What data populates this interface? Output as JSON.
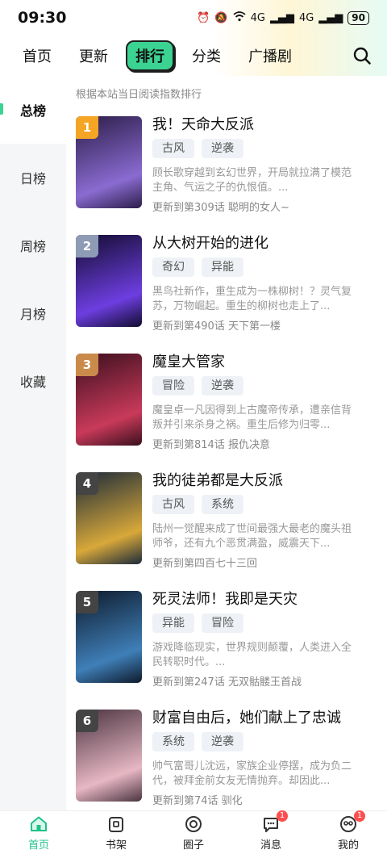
{
  "status_bar": {
    "time": "09:30",
    "signal_a": "4G",
    "signal_b": "4G",
    "battery": "90"
  },
  "top_nav": {
    "tabs": [
      "首页",
      "更新",
      "排行",
      "分类",
      "广播剧"
    ],
    "active_tab": "排行"
  },
  "side_nav": {
    "items": [
      "总榜",
      "日榜",
      "周榜",
      "月榜",
      "收藏"
    ],
    "active": "总榜"
  },
  "ranking_note": "根据本站当日阅读指数排行",
  "rankings": [
    {
      "rank": "1",
      "badge_color": "#f5a524",
      "title": "我！天命大反派",
      "tags": [
        "古风",
        "逆袭"
      ],
      "desc": "顾长歌穿越到玄幻世界，开局就拉满了模范主角、气运之子的仇恨值。...",
      "update": "更新到第309话 聪明的女人~",
      "cover_colors": [
        "#2b1d48",
        "#8a6bd1"
      ]
    },
    {
      "rank": "2",
      "badge_color": "#8e9bb5",
      "title": "从大树开始的进化",
      "tags": [
        "奇幻",
        "异能"
      ],
      "desc": "黑鸟社新作，重生成为一株柳树！？灵气复苏，万物崛起。重生的柳树也走上了...",
      "update": "更新到第490话 天下第一楼",
      "cover_colors": [
        "#120c2e",
        "#6d3ee0"
      ]
    },
    {
      "rank": "3",
      "badge_color": "#c98a4b",
      "title": "魔皇大管家",
      "tags": [
        "冒险",
        "逆袭"
      ],
      "desc": "魔皇卓一凡因得到上古魔帝传承，遭亲信背叛并引来杀身之祸。重生后修为归零...",
      "update": "更新到第814话 报仇决意",
      "cover_colors": [
        "#3a0f1e",
        "#c93a5a"
      ]
    },
    {
      "rank": "4",
      "badge_color": "#444444",
      "title": "我的徒弟都是大反派",
      "tags": [
        "古风",
        "系统"
      ],
      "desc": "陆州一觉醒来成了世间最强大最老的魔头祖师爷，还有九个恶贯满盈，威震天下...",
      "update": "更新到第四百七十三回",
      "cover_colors": [
        "#1b2a3a",
        "#d8a83a"
      ]
    },
    {
      "rank": "5",
      "badge_color": "#444444",
      "title": "死灵法师！我即是天灾",
      "tags": [
        "异能",
        "冒险"
      ],
      "desc": "游戏降临现实，世界规则颠覆，人类进入全民转职时代。...",
      "update": "更新到第247话 无双骷髅王首战",
      "cover_colors": [
        "#0e1a2b",
        "#3f7fb8"
      ]
    },
    {
      "rank": "6",
      "badge_color": "#444444",
      "title": "财富自由后，她们献上了忠诚",
      "tags": [
        "系统",
        "逆袭"
      ],
      "desc": "帅气富哥儿沈远，家族企业停摆，成为负二代，被拜金前女友无情抛弃。却因此...",
      "update": "更新到第74话 驯化",
      "cover_colors": [
        "#4a3440",
        "#e7b7c4"
      ]
    }
  ],
  "bottom_nav": {
    "items": [
      {
        "label": "首页",
        "icon": "home-icon",
        "badge": ""
      },
      {
        "label": "书架",
        "icon": "bookshelf-icon",
        "badge": ""
      },
      {
        "label": "圈子",
        "icon": "circle-icon",
        "badge": ""
      },
      {
        "label": "消息",
        "icon": "message-icon",
        "badge": "1"
      },
      {
        "label": "我的",
        "icon": "profile-icon",
        "badge": "1"
      }
    ],
    "active": "首页"
  },
  "colors": {
    "accent": "#3bd392",
    "accent_text": "#1ec28a",
    "badge": "#ff4d4f"
  }
}
